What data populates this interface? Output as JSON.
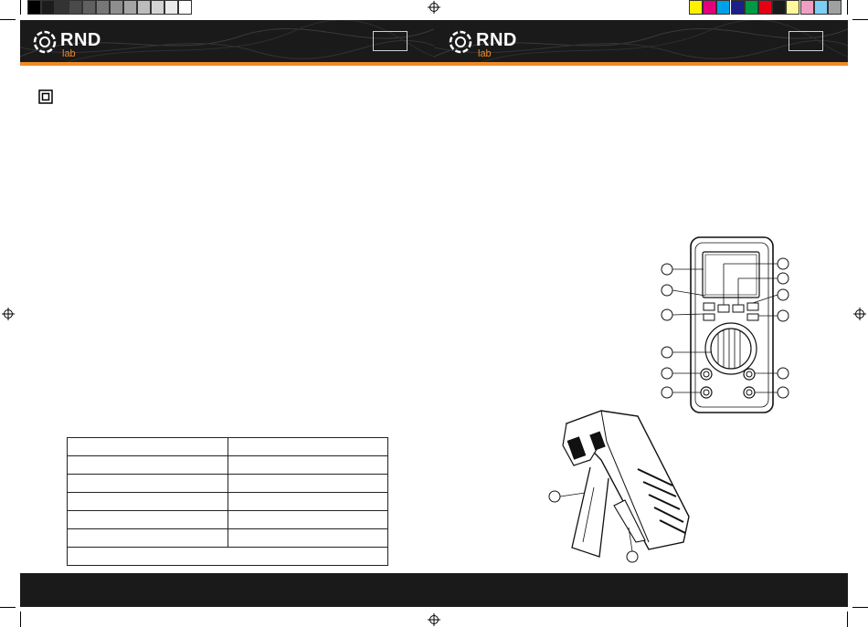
{
  "color_bar_left": [
    "#000000",
    "#1c1c1c",
    "#333333",
    "#4a4a4a",
    "#606060",
    "#777777",
    "#8e8e8e",
    "#a5a5a5",
    "#bcbcbc",
    "#d3d3d3",
    "#eaeaea",
    "#ffffff"
  ],
  "color_bar_right": [
    "#ffef00",
    "#e4007c",
    "#00a0e9",
    "#1d2088",
    "#009944",
    "#e60012",
    "#1a1a1a",
    "#fff799",
    "#f19ec2",
    "#7ecef4",
    "#9fa0a0"
  ],
  "header": {
    "brand": "RND",
    "sub": "lab",
    "accent": "#f08a24"
  },
  "spec_table": {
    "rows": [
      [
        "",
        ""
      ],
      [
        "",
        ""
      ],
      [
        "",
        ""
      ],
      [
        "",
        ""
      ],
      [
        "",
        ""
      ],
      [
        "",
        ""
      ]
    ],
    "footer_row": ""
  },
  "front_view": {
    "callouts_left": [
      "",
      "",
      "",
      "",
      "",
      ""
    ],
    "callouts_right": [
      "",
      "",
      "",
      "",
      "",
      ""
    ]
  },
  "side_view": {
    "callouts": [
      "",
      ""
    ]
  }
}
